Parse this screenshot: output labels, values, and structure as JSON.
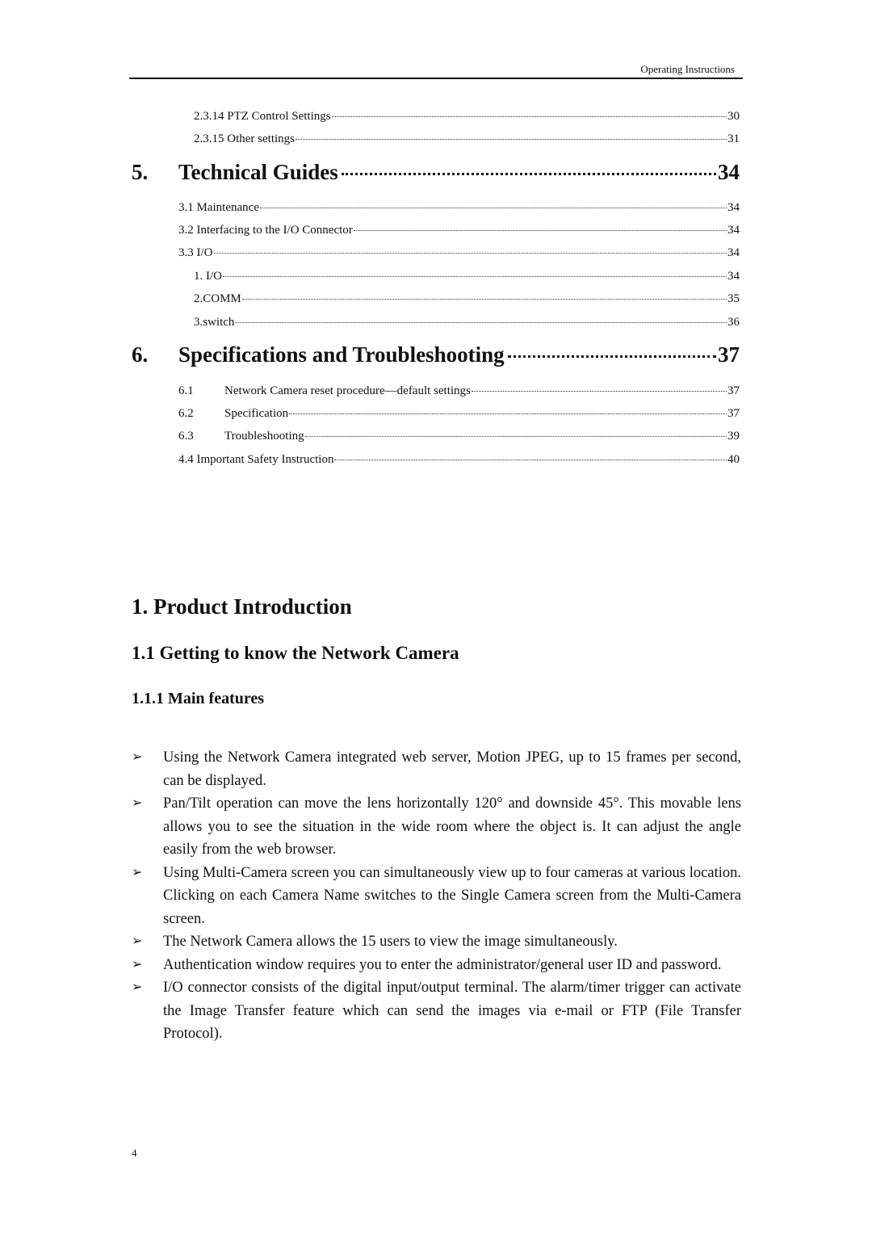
{
  "header": {
    "running_title": "Operating Instructions"
  },
  "toc": {
    "pre_entries": [
      {
        "label": "2.3.14 PTZ Control Settings",
        "page": "30"
      },
      {
        "label": "2.3.15 Other settings",
        "page": "31"
      }
    ],
    "chapter5": {
      "number": "5.",
      "title": "Technical Guides",
      "page": "34",
      "entries": [
        {
          "label": "3.1 Maintenance",
          "page": "34"
        },
        {
          "label": "3.2 Interfacing to the I/O Connector",
          "page": "34"
        },
        {
          "label": "3.3 I/O",
          "page": "34"
        },
        {
          "label": "1. I/O",
          "page": "34"
        },
        {
          "label": "2.COMM",
          "page": "35"
        },
        {
          "label": "3.switch",
          "page": "36"
        }
      ]
    },
    "chapter6": {
      "number": "6.",
      "title": "Specifications and Troubleshooting",
      "page": "37",
      "entries": [
        {
          "num": "6.1",
          "label": "Network Camera reset procedure—default settings",
          "page": "37"
        },
        {
          "num": "6.2",
          "label": "Specification",
          "page": "37"
        },
        {
          "num": "6.3",
          "label": "Troubleshooting",
          "page": "39"
        },
        {
          "num": "",
          "label": "4.4 Important Safety Instruction",
          "page": "40"
        }
      ]
    }
  },
  "body": {
    "h1": "1. Product Introduction",
    "h2": "1.1 Getting to know the Network Camera",
    "h3": "1.1.1 Main features",
    "bullet_icon": "➢",
    "features": [
      "Using the Network Camera integrated web server, Motion JPEG, up to 15 frames per second, can be displayed.",
      "Pan/Tilt operation can move the lens horizontally 120° and downside 45°. This movable lens allows you to see the situation in the wide room where the object is. It can adjust the angle easily from the web browser.",
      "Using Multi-Camera screen you can simultaneously view up to four cameras at various location. Clicking on each Camera Name switches to the Single Camera screen from the Multi-Camera screen.",
      "The Network Camera allows the 15 users to view the image simultaneously.",
      "Authentication window requires you to enter the administrator/general user ID and password.",
      "I/O connector consists of the digital input/output terminal. The alarm/timer trigger can activate the Image Transfer feature which can send the images via e-mail or FTP (File Transfer Protocol)."
    ]
  },
  "footer": {
    "page_number": "4"
  }
}
